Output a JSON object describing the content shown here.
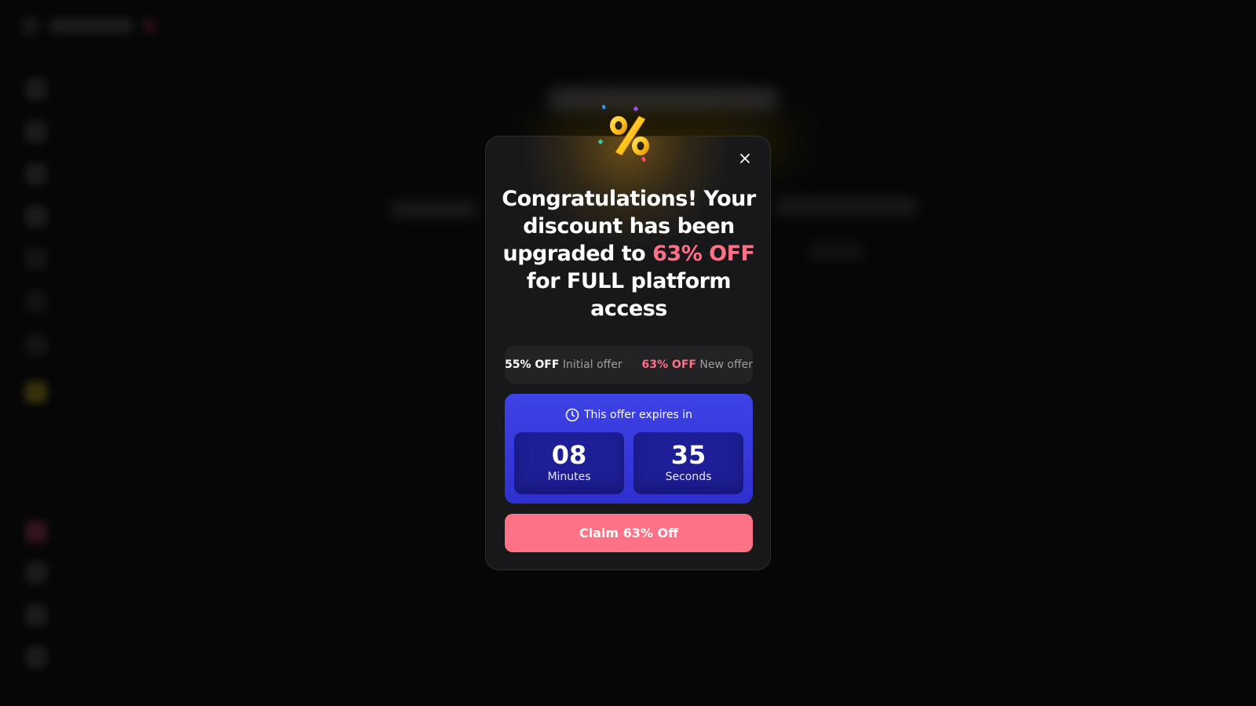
{
  "modal": {
    "headline_part1": "Congratulations! Your discount has been upgraded to",
    "headline_accent": "63% OFF",
    "headline_part2": "for FULL platform access",
    "offer_compare": {
      "initial_value": "55% OFF",
      "initial_label": "Initial offer",
      "new_value": "63% OFF",
      "new_label": "New offer"
    },
    "timer": {
      "heading": "This offer expires in",
      "minutes_value": "08",
      "minutes_label": "Minutes",
      "seconds_value": "35",
      "seconds_label": "Seconds"
    },
    "claim_button_label": "Claim 63% Off",
    "icons": {
      "close": "close-icon",
      "clock": "clock-icon",
      "arrow": "arrow-right-icon",
      "percent": "percent-emoji-icon"
    }
  },
  "colors": {
    "accent_pink": "#ff6f86",
    "button_pink": "#fd7286",
    "timer_blue": "#3e43e6",
    "timer_box_blue": "#1e1f96",
    "modal_bg": "#18181b"
  }
}
